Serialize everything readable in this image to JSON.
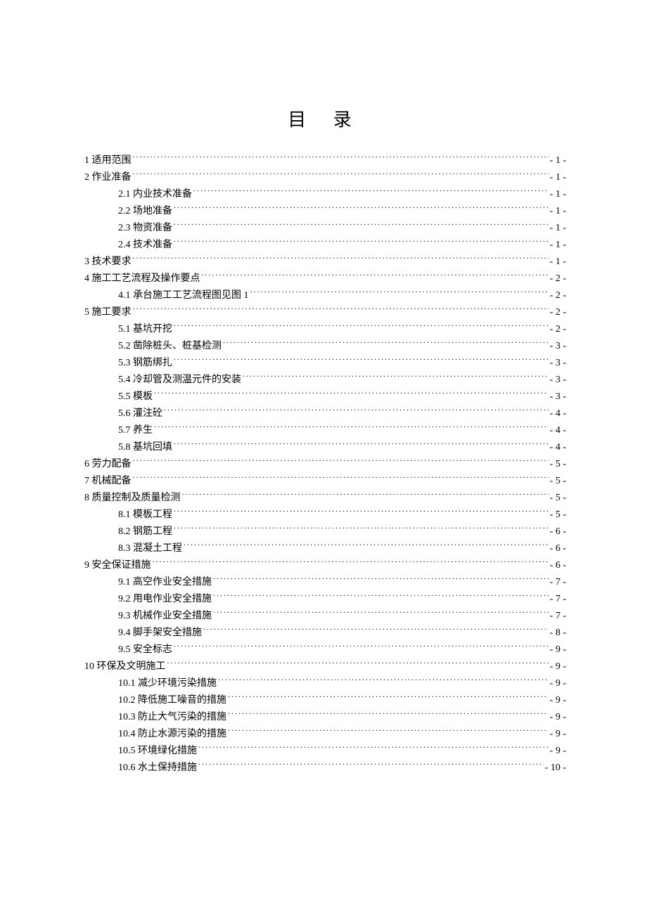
{
  "title": "目 录",
  "entries": [
    {
      "level": 1,
      "num": "1",
      "label": "适用范围",
      "page": "- 1 -"
    },
    {
      "level": 1,
      "num": "2",
      "label": "作业准备",
      "page": "- 1 -"
    },
    {
      "level": 2,
      "num": "2.1",
      "label": "内业技术准备",
      "page": "- 1 -"
    },
    {
      "level": 2,
      "num": "2.2",
      "label": "场地准备",
      "page": "- 1 -"
    },
    {
      "level": 2,
      "num": "2.3",
      "label": "物资准备",
      "page": "- 1 -"
    },
    {
      "level": 2,
      "num": "2.4",
      "label": "技术准备",
      "page": "- 1 -"
    },
    {
      "level": 1,
      "num": "3 ",
      "label": "技术要求",
      "page": "- 1 -"
    },
    {
      "level": 1,
      "num": "4 ",
      "label": "施工工艺流程及操作要点",
      "page": "- 2 -"
    },
    {
      "level": 2,
      "num": "4.1 ",
      "label": "承台施工工艺流程图见图 1",
      "page": "- 2 -"
    },
    {
      "level": 1,
      "num": "5",
      "label": "施工要求",
      "page": "- 2 -"
    },
    {
      "level": 2,
      "num": "5.1",
      "label": "基坑开挖",
      "page": "- 2 -"
    },
    {
      "level": 2,
      "num": "5.2",
      "label": "凿除桩头、桩基检测",
      "page": "- 3 -"
    },
    {
      "level": 2,
      "num": "5.3",
      "label": "钢筋绑扎",
      "page": "- 3 -"
    },
    {
      "level": 2,
      "num": "5.4",
      "label": "冷却管及测温元件的安装",
      "page": "- 3 -"
    },
    {
      "level": 2,
      "num": "5.5",
      "label": "模板",
      "page": "- 3 -"
    },
    {
      "level": 2,
      "num": "5.6",
      "label": "灌注砼",
      "page": "- 4 -"
    },
    {
      "level": 2,
      "num": "5.7",
      "label": "养生",
      "page": "- 4 -"
    },
    {
      "level": 2,
      "num": "5.8",
      "label": "基坑回填",
      "page": "- 4 -"
    },
    {
      "level": 1,
      "num": "6 ",
      "label": "劳力配备",
      "page": "- 5 -"
    },
    {
      "level": 1,
      "num": "7 ",
      "label": "机械配备",
      "page": "- 5 -"
    },
    {
      "level": 1,
      "num": "8 ",
      "label": "质量控制及质量检测",
      "page": "- 5 -"
    },
    {
      "level": 2,
      "num": "8.1",
      "label": "模板工程",
      "page": "- 5 -"
    },
    {
      "level": 2,
      "num": "8.2",
      "label": "钢筋工程",
      "page": "- 6 -"
    },
    {
      "level": 2,
      "num": "8.3",
      "label": "混凝土工程",
      "page": "- 6 -"
    },
    {
      "level": 1,
      "num": "9 ",
      "label": "安全保证措施",
      "page": "- 6 -"
    },
    {
      "level": 2,
      "num": "9.1",
      "label": "高空作业安全措施",
      "page": "- 7 -"
    },
    {
      "level": 2,
      "num": "9.2",
      "label": "用电作业安全措施",
      "page": "- 7 -"
    },
    {
      "level": 2,
      "num": "9.3",
      "label": "机械作业安全措施",
      "page": "- 7 -"
    },
    {
      "level": 2,
      "num": "9.4",
      "label": "脚手架安全措施",
      "page": "- 8 -"
    },
    {
      "level": 2,
      "num": "9.5",
      "label": "安全标志",
      "page": "- 9 -"
    },
    {
      "level": 1,
      "num": "10",
      "label": "环保及文明施工",
      "page": "- 9 -"
    },
    {
      "level": 2,
      "num": "10.1",
      "label": "减少环境污染措施",
      "page": "- 9 -"
    },
    {
      "level": 2,
      "num": "10.2",
      "label": "降低施工噪音的措施",
      "page": "- 9 -"
    },
    {
      "level": 2,
      "num": "10.3",
      "label": "防止大气污染的措施",
      "page": "- 9 -"
    },
    {
      "level": 2,
      "num": "10.4",
      "label": "防止水源污染的措施",
      "page": "- 9 -"
    },
    {
      "level": 2,
      "num": "10.5",
      "label": "环境绿化措施",
      "page": "- 9 -"
    },
    {
      "level": 2,
      "num": "10.6",
      "label": "水土保持措施",
      "page": "- 10 -"
    }
  ]
}
